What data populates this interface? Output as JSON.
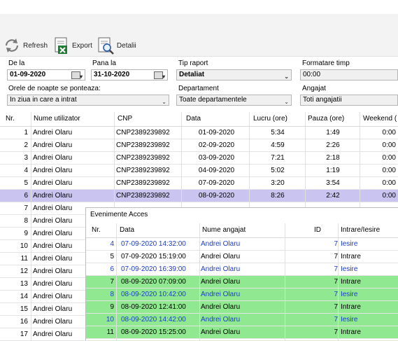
{
  "toolbar": {
    "refresh_label": "Refresh",
    "export_label": "Export",
    "details_label": "Detalii"
  },
  "filters": {
    "from_label": "De la",
    "from_value": "01-09-2020",
    "to_label": "Pana la",
    "to_value": "31-10-2020",
    "report_type_label": "Tip raport",
    "report_type_value": "Detaliat",
    "time_format_label": "Formatare timp",
    "time_format_value": "00:00",
    "night_hours_label": "Orele de noapte se ponteaza:",
    "night_hours_value": "In ziua in care a intrat",
    "department_label": "Departament",
    "department_value": "Toate departamentele",
    "employee_label": "Angajat",
    "employee_value": "Toti angajatii"
  },
  "grid": {
    "columns": [
      "Nr.",
      "Nume utilizator",
      "CNP",
      "Data",
      "Lucru (ore)",
      "Pauza (ore)",
      "Weekend ("
    ],
    "rows": [
      {
        "nr": "1",
        "name": "Andrei Olaru",
        "cnp": "CNP2389239892",
        "date": "01-09-2020",
        "work": "5:34",
        "pause": "1:49",
        "weekend": "0:00"
      },
      {
        "nr": "2",
        "name": "Andrei Olaru",
        "cnp": "CNP2389239892",
        "date": "02-09-2020",
        "work": "4:59",
        "pause": "2:26",
        "weekend": "0:00"
      },
      {
        "nr": "3",
        "name": "Andrei Olaru",
        "cnp": "CNP2389239892",
        "date": "03-09-2020",
        "work": "7:21",
        "pause": "2:18",
        "weekend": "0:00"
      },
      {
        "nr": "4",
        "name": "Andrei Olaru",
        "cnp": "CNP2389239892",
        "date": "04-09-2020",
        "work": "5:02",
        "pause": "1:19",
        "weekend": "0:00"
      },
      {
        "nr": "5",
        "name": "Andrei Olaru",
        "cnp": "CNP2389239892",
        "date": "07-09-2020",
        "work": "3:20",
        "pause": "3:54",
        "weekend": "0:00"
      },
      {
        "nr": "6",
        "name": "Andrei Olaru",
        "cnp": "CNP2389239892",
        "date": "08-09-2020",
        "work": "8:26",
        "pause": "2:42",
        "weekend": "0:00"
      },
      {
        "nr": "7",
        "name": "Andrei Olaru",
        "cnp": "",
        "date": "",
        "work": "",
        "pause": "",
        "weekend": ""
      },
      {
        "nr": "8",
        "name": "Andrei Olaru",
        "cnp": "",
        "date": "",
        "work": "",
        "pause": "",
        "weekend": ""
      },
      {
        "nr": "9",
        "name": "Andrei Olaru",
        "cnp": "",
        "date": "",
        "work": "",
        "pause": "",
        "weekend": ""
      },
      {
        "nr": "10",
        "name": "Andrei Olaru",
        "cnp": "",
        "date": "",
        "work": "",
        "pause": "",
        "weekend": ""
      },
      {
        "nr": "11",
        "name": "Andrei Olaru",
        "cnp": "",
        "date": "",
        "work": "",
        "pause": "",
        "weekend": ""
      },
      {
        "nr": "12",
        "name": "Andrei Olaru",
        "cnp": "",
        "date": "",
        "work": "",
        "pause": "",
        "weekend": ""
      },
      {
        "nr": "13",
        "name": "Andrei Olaru",
        "cnp": "",
        "date": "",
        "work": "",
        "pause": "",
        "weekend": ""
      },
      {
        "nr": "14",
        "name": "Andrei Olaru",
        "cnp": "",
        "date": "",
        "work": "",
        "pause": "",
        "weekend": ""
      },
      {
        "nr": "15",
        "name": "Andrei Olaru",
        "cnp": "",
        "date": "",
        "work": "",
        "pause": "",
        "weekend": ""
      },
      {
        "nr": "16",
        "name": "Andrei Olaru",
        "cnp": "",
        "date": "",
        "work": "",
        "pause": "",
        "weekend": ""
      },
      {
        "nr": "17",
        "name": "Andrei Olaru",
        "cnp": "",
        "date": "",
        "work": "",
        "pause": "",
        "weekend": ""
      }
    ]
  },
  "popup": {
    "title": "Evenimente Acces",
    "columns": [
      "Nr.",
      "Data",
      "Nume angajat",
      "ID",
      "Intrare/Iesire"
    ],
    "rows": [
      {
        "nr": "4",
        "date": "07-09-2020 14:32:00",
        "name": "Andrei Olaru",
        "id": "7",
        "dir": "Iesire",
        "style": "blue"
      },
      {
        "nr": "5",
        "date": "07-09-2020 15:19:00",
        "name": "Andrei Olaru",
        "id": "7",
        "dir": "Intrare",
        "style": "plain"
      },
      {
        "nr": "6",
        "date": "07-09-2020 16:39:00",
        "name": "Andrei Olaru",
        "id": "7",
        "dir": "Iesire",
        "style": "blue"
      },
      {
        "nr": "7",
        "date": "08-09-2020 07:09:00",
        "name": "Andrei Olaru",
        "id": "7",
        "dir": "Intrare",
        "style": "green"
      },
      {
        "nr": "8",
        "date": "08-09-2020 10:42:00",
        "name": "Andrei Olaru",
        "id": "7",
        "dir": "Iesire",
        "style": "green-blue"
      },
      {
        "nr": "9",
        "date": "08-09-2020 12:41:00",
        "name": "Andrei Olaru",
        "id": "7",
        "dir": "Intrare",
        "style": "green"
      },
      {
        "nr": "10",
        "date": "08-09-2020 14:42:00",
        "name": "Andrei Olaru",
        "id": "7",
        "dir": "Iesire",
        "style": "green-blue"
      },
      {
        "nr": "11",
        "date": "08-09-2020 15:25:00",
        "name": "Andrei Olaru",
        "id": "7",
        "dir": "Intrare",
        "style": "green"
      }
    ]
  },
  "colors": {
    "selected_row": "#c9c5f0",
    "green_row": "#90e890",
    "exit_text": "#1a3ad6"
  }
}
